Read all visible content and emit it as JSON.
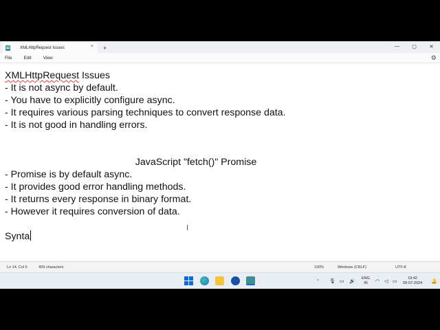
{
  "window": {
    "tab_title": "XMLHttpRequest Issues",
    "tab_close": "×",
    "new_tab": "+",
    "minimize": "—",
    "maximize": "▢",
    "close": "✕"
  },
  "menu": {
    "file": "File",
    "edit": "Edit",
    "view": "View",
    "settings_icon": "gear-icon"
  },
  "document": {
    "heading_word": "XMLHttpRequest",
    "heading_rest": " Issues",
    "xhr_points": [
      "- It is not async by default.",
      "- You have to explicitly configure async.",
      "- It requires various parsing techniques to convert response data.",
      "- It is not good in handling errors."
    ],
    "fetch_heading": "JavaScript \"fetch()\" Promise",
    "fetch_points": [
      "- Promise is by default async.",
      "- It provides good error handling methods.",
      "- It returns every response in binary format.",
      "- However it requires conversion of data."
    ],
    "last_line": "Synta"
  },
  "status": {
    "position": "Ln 14, Col 6",
    "characters": "409 characters",
    "zoom": "100%",
    "line_ending": "Windows (CRLF)",
    "encoding": "UTF-8"
  },
  "taskbar": {
    "lang_top": "ENG",
    "lang_bottom": "IN",
    "time": "19:42",
    "date": "09-07-2024",
    "tray_chevron": "^"
  }
}
